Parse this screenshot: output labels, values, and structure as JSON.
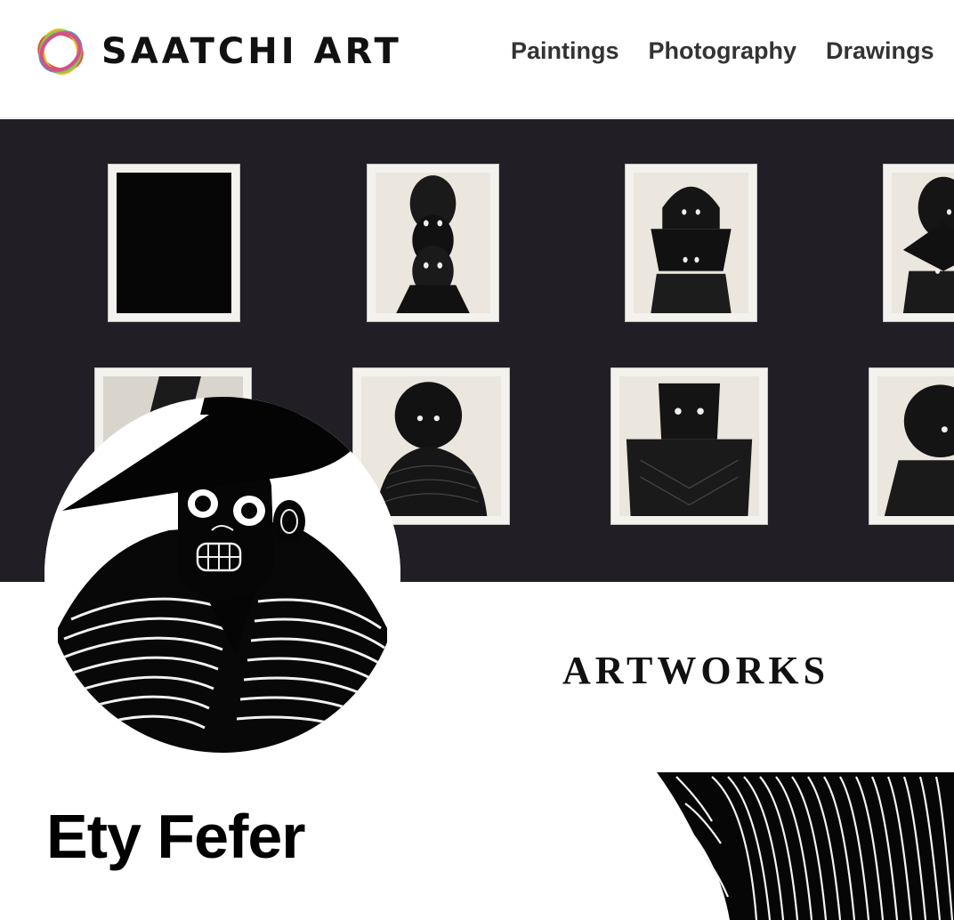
{
  "brand": {
    "name": "SAATCHI ART",
    "logo_icon": "interlocking-rings-logo",
    "ring_colors": [
      "#e94b3c",
      "#f6b72b",
      "#3aa6d8",
      "#8ac44a",
      "#d9478d"
    ]
  },
  "nav": {
    "items": [
      {
        "label": "Paintings"
      },
      {
        "label": "Photography"
      },
      {
        "label": "Drawings"
      }
    ]
  },
  "banner": {
    "background": "#211e26",
    "description_icon": "gallery-wall-photo"
  },
  "artist": {
    "name": "Ety Fefer",
    "avatar_icon": "figure-with-hat-avatar"
  },
  "sections": {
    "artworks_heading": "ARTWORKS"
  }
}
